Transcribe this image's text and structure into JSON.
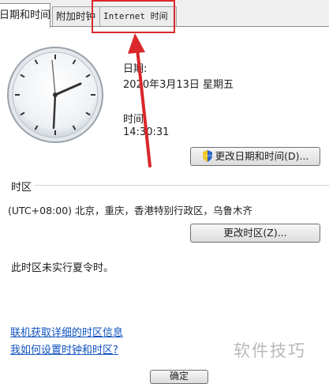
{
  "tabs": [
    {
      "label": "日期和时间",
      "active": true
    },
    {
      "label": "附加时钟",
      "active": false
    },
    {
      "label": "Internet 时间",
      "active": false
    }
  ],
  "date_label": "日期:",
  "date_value": "2020年3月13日 星期五",
  "time_label": "时间:",
  "time_value": "14:30:31",
  "change_datetime_button": "更改日期和时间(D)...",
  "timezone_section_title": "时区",
  "timezone_value": "(UTC+08:00) 北京，重庆，香港特别行政区，乌鲁木齐",
  "change_timezone_button": "更改时区(Z)...",
  "dst_note": "此时区未实行夏令时。",
  "links": {
    "online_info": "联机获取详细的时区信息",
    "how_to_set": "我如何设置时钟和时区?"
  },
  "ok_button": "确定",
  "watermark": "软件技巧",
  "colors": {
    "highlight": "#d9272a",
    "link": "#0f52bd",
    "shield_blue": "#2f66c8",
    "shield_yellow": "#f3c81c"
  }
}
